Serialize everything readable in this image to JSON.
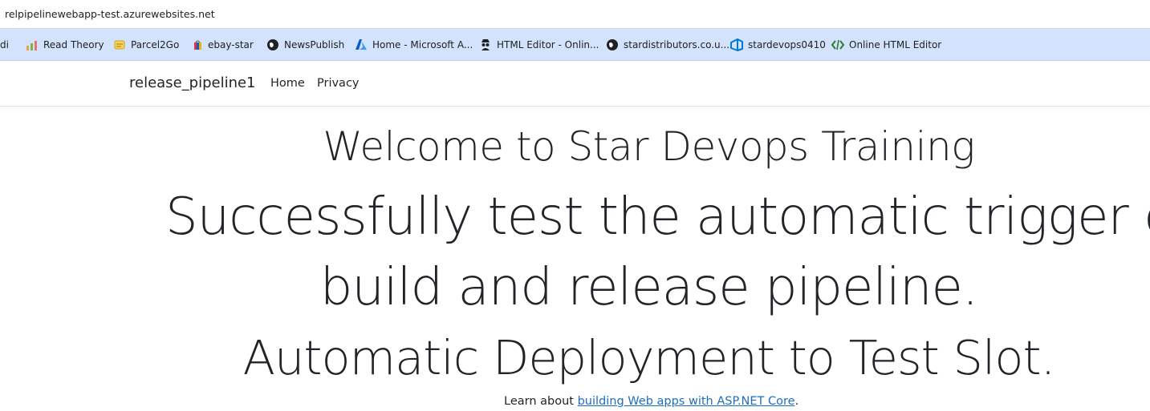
{
  "browser": {
    "url": "relpipelinewebapp-test.azurewebsites.net",
    "bookmarks": [
      {
        "label": "di",
        "icon": "bookmark-icon"
      },
      {
        "label": "Read Theory",
        "icon": "bar-chart-icon"
      },
      {
        "label": "Parcel2Go",
        "icon": "box-icon"
      },
      {
        "label": "ebay-star",
        "icon": "bag-icon"
      },
      {
        "label": "NewsPublish",
        "icon": "globe-icon"
      },
      {
        "label": "Home - Microsoft A...",
        "icon": "azure-icon"
      },
      {
        "label": "HTML Editor - Onlin...",
        "icon": "spy-icon"
      },
      {
        "label": "stardistributors.co.u...",
        "icon": "globe-icon"
      },
      {
        "label": "stardevops0410",
        "icon": "azure-devops-icon"
      },
      {
        "label": "Online HTML Editor",
        "icon": "code-icon"
      }
    ]
  },
  "navbar": {
    "brand": "release_pipeline1",
    "links": [
      "Home",
      "Privacy"
    ]
  },
  "main": {
    "welcome": "Welcome to Star Devops Training",
    "success_line1": "Successfully test the automatic trigger of",
    "success_line2": "build and release pipeline.",
    "deployment": "Automatic Deployment to Test Slot.",
    "learn_prefix": "Learn about ",
    "learn_link": "building Web apps with ASP.NET Core",
    "learn_suffix": "."
  },
  "colors": {
    "bookmark_bar": "#d3e3fd",
    "link": "#1b6ec2",
    "text": "#212529"
  }
}
